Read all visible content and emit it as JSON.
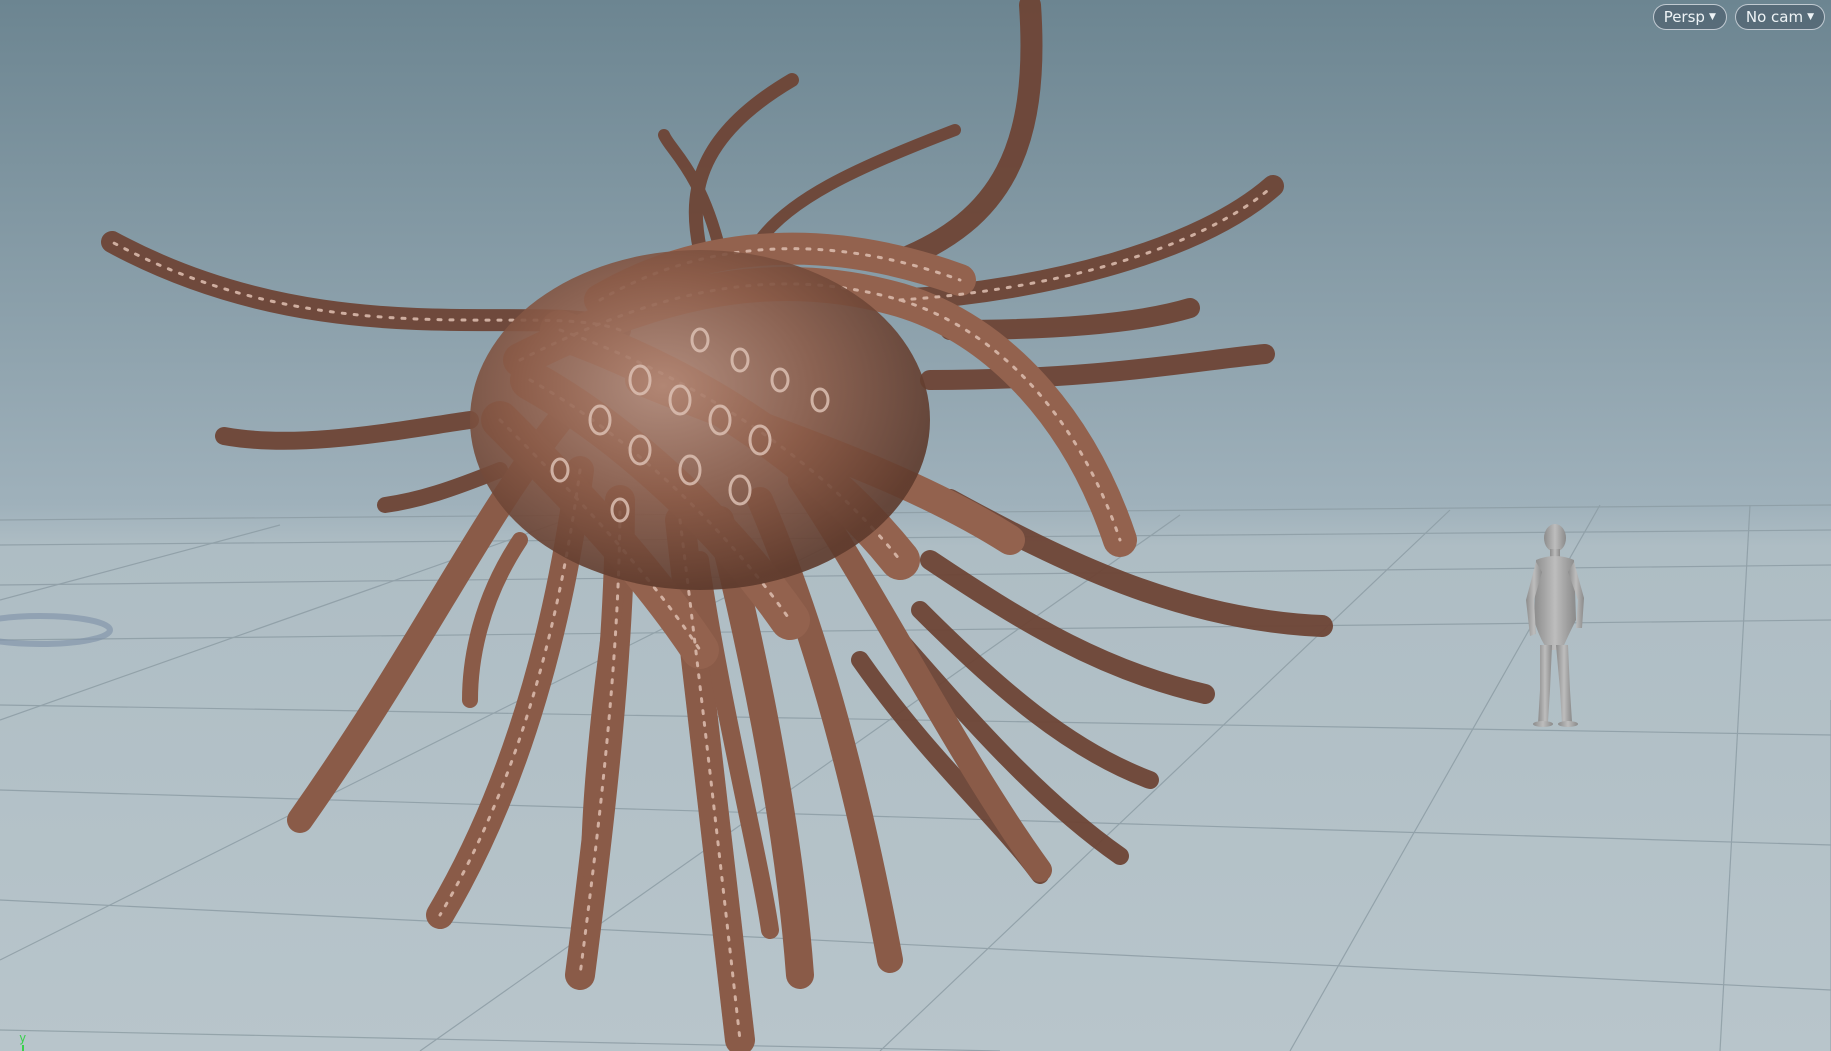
{
  "viewport": {
    "camera_menu": "Persp",
    "camera_select": "No cam",
    "axis_label": "y"
  },
  "colors": {
    "sky_top": "#6f8794",
    "sky_horizon": "#a7b8c1",
    "floor": "#b3c0c6",
    "grid_line": "#8e9ea6",
    "creature": "#8a5b48",
    "creature_highlight": "#c8a596",
    "human_figure": "#a9a9a9",
    "axis_green": "#39d04c"
  }
}
